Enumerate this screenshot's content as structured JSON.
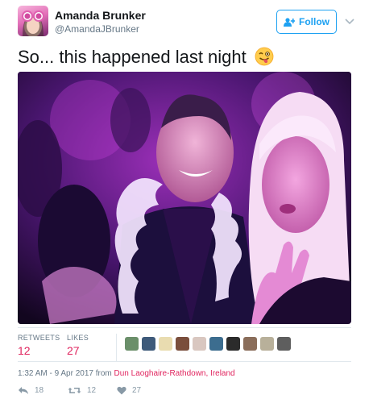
{
  "user": {
    "display_name": "Amanda Brunker",
    "screen_name": "@AmandaJBrunker"
  },
  "follow_button": {
    "label": "Follow",
    "icon": "add-user-icon"
  },
  "tweet": {
    "text": "So... this happened last night",
    "emoji": "winking-face-with-tongue-icon"
  },
  "stats": {
    "retweets_label": "RETWEETS",
    "retweets_value": "12",
    "likes_label": "LIKES",
    "likes_value": "27",
    "liker_avatar_count": 10
  },
  "meta": {
    "timestamp": "1:32 AM - 9 Apr 2017",
    "from_word": "from",
    "location": "Dun Laoghaire-Rathdown, Ireland"
  },
  "actions": {
    "reply_count": "18",
    "retweet_count": "12",
    "like_count": "27"
  },
  "colors": {
    "accent_blue": "#1da1f2",
    "count_red": "#e0245e",
    "muted_gray": "#657786"
  }
}
